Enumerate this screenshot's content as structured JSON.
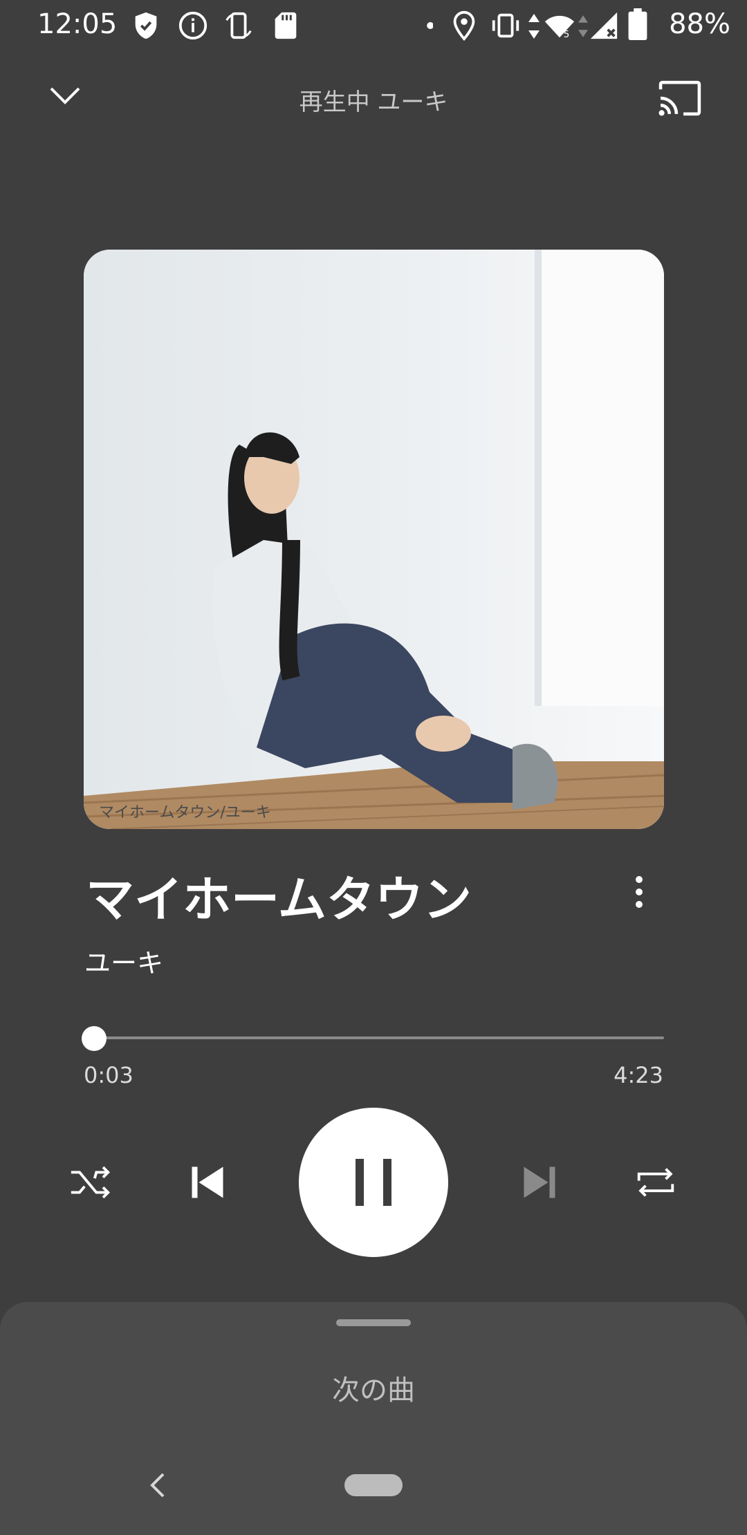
{
  "status_bar": {
    "time": "12:05",
    "battery_percent": "88%",
    "icons": [
      "shield-check-icon",
      "info-icon",
      "screen-rotate-icon",
      "sd-card-icon",
      "dot-icon",
      "location-icon",
      "vibrate-icon",
      "data-arrows-icon",
      "wifi-icon",
      "signal-icon",
      "battery-icon"
    ]
  },
  "header": {
    "title": "再生中 ユーキ",
    "collapse_icon": "chevron-down-icon",
    "cast_icon": "cast-icon"
  },
  "album": {
    "caption": "マイホームタウン/ユーキ"
  },
  "track": {
    "title": "マイホームタウン",
    "artist": "ユーキ"
  },
  "progress": {
    "current": "0:03",
    "total": "4:23",
    "fraction": 0.011
  },
  "controls": {
    "shuffle": "shuffle-icon",
    "previous": "skip-previous-icon",
    "pause": "pause-icon",
    "next": "skip-next-icon",
    "repeat": "repeat-icon"
  },
  "bottom_sheet": {
    "label": "次の曲"
  },
  "colors": {
    "background": "#3e3e3e",
    "sheet": "#4b4b4b",
    "disabled_icon": "#8a8a8a"
  }
}
